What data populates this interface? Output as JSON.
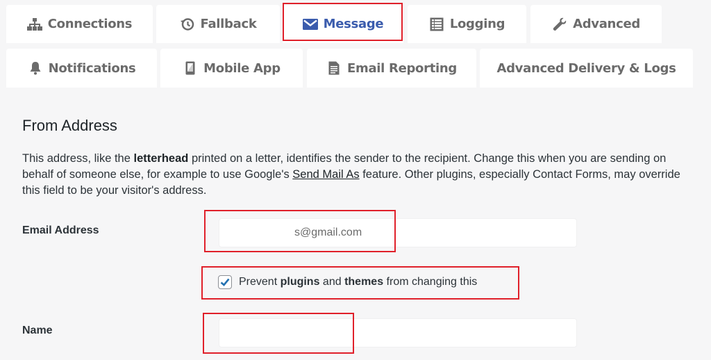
{
  "tabs": [
    {
      "id": "connections",
      "label": "Connections",
      "icon": "sitemap-icon",
      "active": false
    },
    {
      "id": "fallback",
      "label": "Fallback",
      "icon": "history-icon",
      "active": false
    },
    {
      "id": "message",
      "label": "Message",
      "icon": "envelope-icon",
      "active": true
    },
    {
      "id": "logging",
      "label": "Logging",
      "icon": "list-icon",
      "active": false
    },
    {
      "id": "advanced",
      "label": "Advanced",
      "icon": "wrench-icon",
      "active": false
    },
    {
      "id": "notifications",
      "label": "Notifications",
      "icon": "bell-icon",
      "active": false
    },
    {
      "id": "mobile-app",
      "label": "Mobile App",
      "icon": "mobile-icon",
      "active": false
    },
    {
      "id": "email-reporting",
      "label": "Email Reporting",
      "icon": "document-icon",
      "active": false
    },
    {
      "id": "advanced-delivery",
      "label": "Advanced Delivery & Logs",
      "icon": "",
      "active": false
    }
  ],
  "colors": {
    "accent": "#3b5cad",
    "highlight_box": "#e0202a",
    "background": "#f6f6f7"
  },
  "section": {
    "title": "From Address",
    "description": {
      "part1": "This address, like the ",
      "bold1": "letterhead",
      "part2": " printed on a letter, identifies the sender to the recipient. Change this when you are sending on behalf of someone else, for example to use Google's ",
      "link": "Send Mail As",
      "part3": " feature. Other plugins, especially Contact Forms, may override this field to be your visitor's address."
    }
  },
  "fields": {
    "email": {
      "label": "Email Address",
      "value": "s@gmail.com"
    },
    "prevent": {
      "pre": "Prevent ",
      "bold1": "plugins",
      "mid": " and ",
      "bold2": "themes",
      "post": " from changing this",
      "checked": true
    },
    "name": {
      "label": "Name",
      "value": ""
    }
  }
}
